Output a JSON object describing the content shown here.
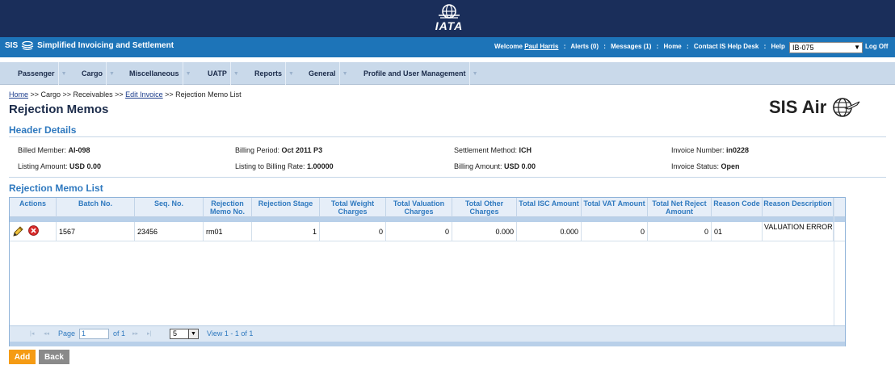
{
  "brand": {
    "iata": "IATA",
    "app_title": "Simplified Invoicing and Settlement",
    "sis_short": "SIS"
  },
  "topnav": {
    "welcome": "Welcome",
    "user": "Paul Harris",
    "alerts": "Alerts (0)",
    "messages": "Messages (1)",
    "home": "Home",
    "contact": "Contact IS Help Desk",
    "help": "Help",
    "member_select": "IB-075",
    "logoff": "Log Off"
  },
  "menu": [
    {
      "label": "Passenger"
    },
    {
      "label": "Cargo"
    },
    {
      "label": "Miscellaneous"
    },
    {
      "label": "UATP"
    },
    {
      "label": "Reports"
    },
    {
      "label": "General"
    },
    {
      "label": "Profile and User Management"
    }
  ],
  "breadcrumb": {
    "home": "Home",
    "path1": " >> Cargo >> Receivables >> ",
    "edit_invoice": "Edit Invoice",
    "path2": " >> Rejection Memo List"
  },
  "page": {
    "title": "Rejection Memos",
    "logo_text": "SIS Air"
  },
  "header_details": {
    "title": "Header Details",
    "billed_member_label": "Billed Member: ",
    "billed_member": "AI-098",
    "billing_period_label": "Billing Period: ",
    "billing_period": "Oct 2011 P3",
    "settlement_method_label": "Settlement Method: ",
    "settlement_method": "ICH",
    "invoice_number_label": "Invoice Number: ",
    "invoice_number": "in0228",
    "listing_amount_label": "Listing Amount: ",
    "listing_amount": "USD 0.00",
    "listing_rate_label": "Listing to Billing Rate: ",
    "listing_rate": "1.00000",
    "billing_amount_label": "Billing Amount: ",
    "billing_amount": "USD 0.00",
    "invoice_status_label": "Invoice Status: ",
    "invoice_status": "Open"
  },
  "memo_list": {
    "title": "Rejection Memo List",
    "columns": [
      "Actions",
      "Batch No.",
      "Seq. No.",
      "Rejection Memo No.",
      "Rejection Stage",
      "Total Weight Charges",
      "Total Valuation Charges",
      "Total Other Charges",
      "Total ISC Amount",
      "Total VAT Amount",
      "Total Net Reject Amount",
      "Reason Code",
      "Reason Description"
    ],
    "rows": [
      {
        "batch_no": "1567",
        "seq_no": "23456",
        "memo_no": "rm01",
        "stage": "1",
        "weight_charges": "0",
        "valuation_charges": "0",
        "other_charges": "0.000",
        "isc_amount": "0.000",
        "vat_amount": "0",
        "net_reject_amount": "0",
        "reason_code": "01",
        "reason_description": "VALUATION ERROR"
      }
    ],
    "pager": {
      "page_label": "Page",
      "page_value": "1",
      "of_label": "of 1",
      "page_size": "5",
      "view_text": "View 1 - 1 of 1"
    }
  },
  "buttons": {
    "add": "Add",
    "back": "Back"
  },
  "colors": {
    "top_navy": "#1a2e5a",
    "sis_blue": "#1d74b8",
    "accent_orange": "#f59b14",
    "grey_button": "#8a8a8a"
  }
}
